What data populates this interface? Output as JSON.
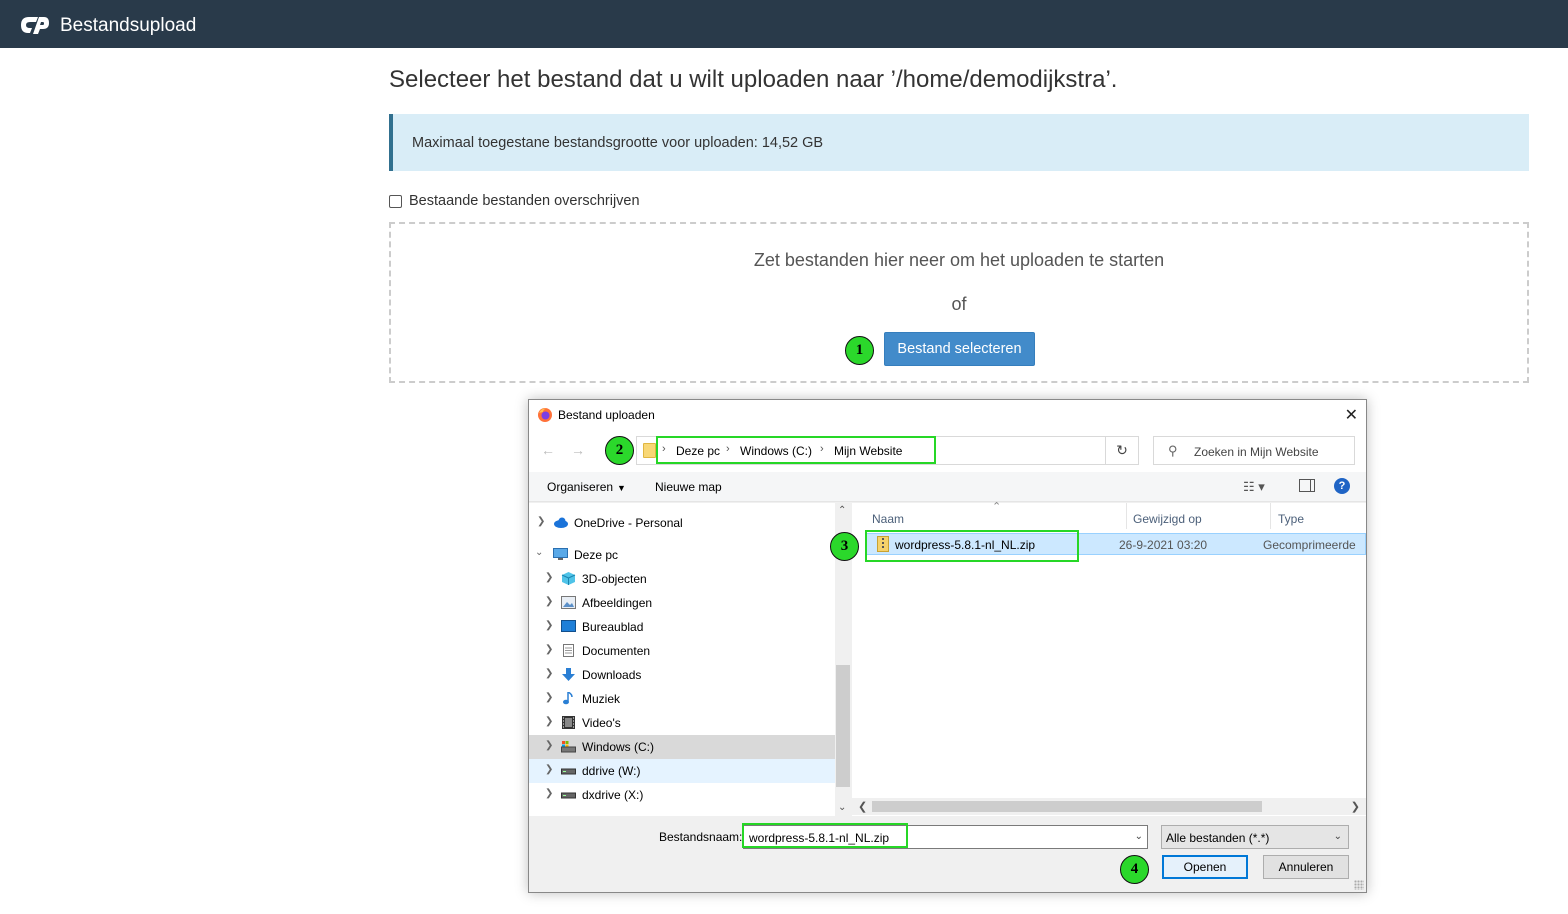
{
  "topbar": {
    "title": "Bestandsupload"
  },
  "page": {
    "heading": "Selecteer het bestand dat u wilt uploaden naar ’/home/demodijkstra’.",
    "info": "Maximaal toegestane bestandsgrootte voor uploaden: 14,52 GB",
    "overwrite_label": "Bestaande bestanden overschrijven",
    "overwrite_checked": false,
    "drop_text": "Zet bestanden hier neer om het uploaden te starten",
    "or_text": "of",
    "select_button": "Bestand selecteren"
  },
  "steps": [
    "1",
    "2",
    "3",
    "4"
  ],
  "dialog": {
    "title": "Bestand uploaden",
    "close_glyph": "✕",
    "breadcrumbs": [
      "Deze pc",
      "Windows (C:)",
      "Mijn Website"
    ],
    "search_placeholder": "Zoeken in Mijn Website",
    "toolbar": {
      "organize": "Organiseren",
      "new_folder": "Nieuwe map"
    },
    "tree": [
      {
        "label": "OneDrive - Personal",
        "icon": "cloud-icon"
      },
      {
        "label": "Deze pc",
        "icon": "computer-icon",
        "expanded": true
      },
      {
        "label": "3D-objecten",
        "icon": "cube-icon"
      },
      {
        "label": "Afbeeldingen",
        "icon": "pictures-icon"
      },
      {
        "label": "Bureaublad",
        "icon": "desktop-icon"
      },
      {
        "label": "Documenten",
        "icon": "document-icon"
      },
      {
        "label": "Downloads",
        "icon": "download-icon"
      },
      {
        "label": "Muziek",
        "icon": "music-icon"
      },
      {
        "label": "Video's",
        "icon": "video-icon"
      },
      {
        "label": "Windows (C:)",
        "icon": "drive-icon",
        "selected": true
      },
      {
        "label": "ddrive (W:)",
        "icon": "drive-icon"
      },
      {
        "label": "dxdrive (X:)",
        "icon": "drive-icon"
      }
    ],
    "columns": {
      "name": "Naam",
      "modified": "Gewijzigd op",
      "type": "Type"
    },
    "files": [
      {
        "name": "wordpress-5.8.1-nl_NL.zip",
        "modified": "26-9-2021 03:20",
        "type": "Gecomprimeerde"
      }
    ],
    "filename_label": "Bestandsnaam:",
    "filename_value": "wordpress-5.8.1-nl_NL.zip",
    "filter": "Alle bestanden (*.*)",
    "open_button": "Openen",
    "cancel_button": "Annuleren",
    "help_glyph": "?"
  },
  "colors": {
    "topbar": "#293a4a",
    "primary_button": "#428bca",
    "info_bg": "#d9edf7",
    "highlight": "#26d726"
  }
}
